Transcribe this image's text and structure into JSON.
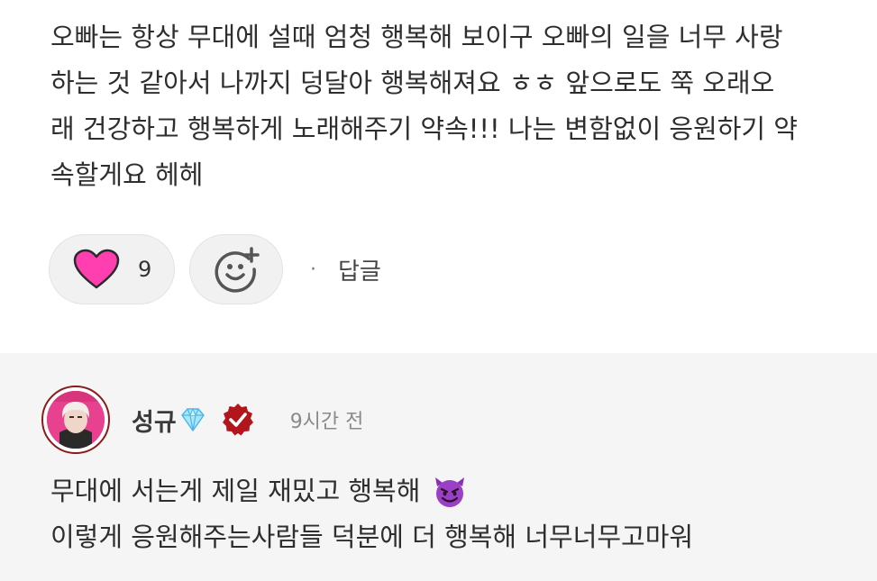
{
  "comment": {
    "text": "오빠는 항상 무대에 설때 엄청 행복해 보이구 오빠의 일을 너무 사랑\n하는 것 같아서 나까지 덩달아 행복해져요 ㅎㅎ 앞으로도 쭉 오래오\n래 건강하고 행복하게 노래해주기 약속!!! 나는 변함없이 응원하기 약\n속할게요 헤헤",
    "like_count": "9",
    "reply_label": "답글",
    "separator": "·"
  },
  "reply": {
    "author": "성규",
    "timestamp": "9시간 전",
    "line1": "무대에 서는게 제일 재밌고 행복해",
    "line2": "이렇게 응원해주는사람들 덕분에 더 행복해 너무너무고마워"
  },
  "icons": {
    "like": "heart-icon",
    "reaction": "add-emoji-icon",
    "badge_gem": "gem-icon",
    "badge_verified": "verified-badge-icon",
    "emoji": "smiling-devil-icon"
  },
  "colors": {
    "heart": "#ff3fb0",
    "verified": "#b3151c",
    "gem": "#7fd4f4",
    "devil": "#9b3fc4",
    "reply_bg": "#f5f5f5"
  }
}
